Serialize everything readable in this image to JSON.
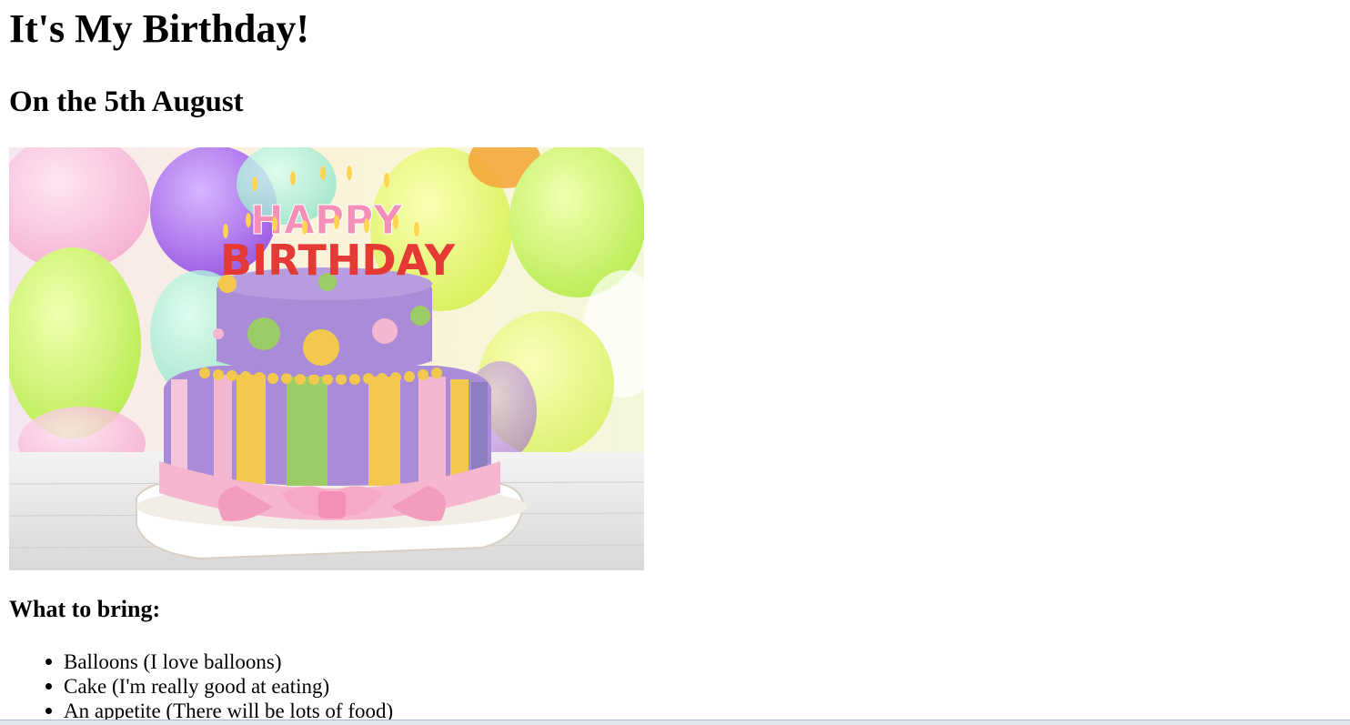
{
  "page": {
    "title": "It's My Birthday!",
    "subtitle": "On the 5th August",
    "image": {
      "icon": "birthday-cake-image",
      "cake_letters_top": "HAPPY",
      "cake_letters_bottom": "BIRTHDAY",
      "colors": {
        "cake_purple": "#a98bd8",
        "ribbon_pink": "#f6b6cf",
        "stripe_yellow": "#f2c94c",
        "stripe_green": "#9ccc65",
        "table_white": "#eeeeee"
      }
    },
    "bring_heading": "What to bring:",
    "bring_items": [
      "Balloons (I love balloons)",
      "Cake (I'm really good at eating)",
      "An appetite (There will be lots of food)"
    ]
  }
}
